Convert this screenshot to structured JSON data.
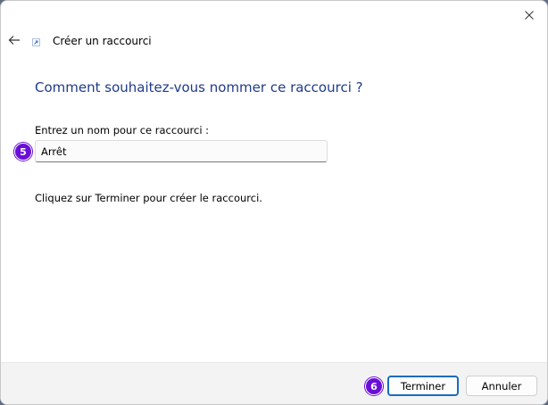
{
  "window": {
    "title": "Créer un raccourci",
    "heading": "Comment souhaitez-vous nommer ce raccourci ?"
  },
  "form": {
    "name_label": "Entrez un nom pour ce raccourci :",
    "name_value": "Arrêt",
    "hint": "Cliquez sur Terminer pour créer le raccourci."
  },
  "footer": {
    "finish_label": "Terminer",
    "cancel_label": "Annuler"
  },
  "badges": {
    "step_a": "5",
    "step_b": "6"
  },
  "icons": {
    "close": "close-icon",
    "back": "back-arrow-icon",
    "shortcut": "shortcut-icon"
  },
  "colors": {
    "heading": "#1f3b8a",
    "badge": "#6a0fd8",
    "focus_border": "#1a6bbd"
  }
}
